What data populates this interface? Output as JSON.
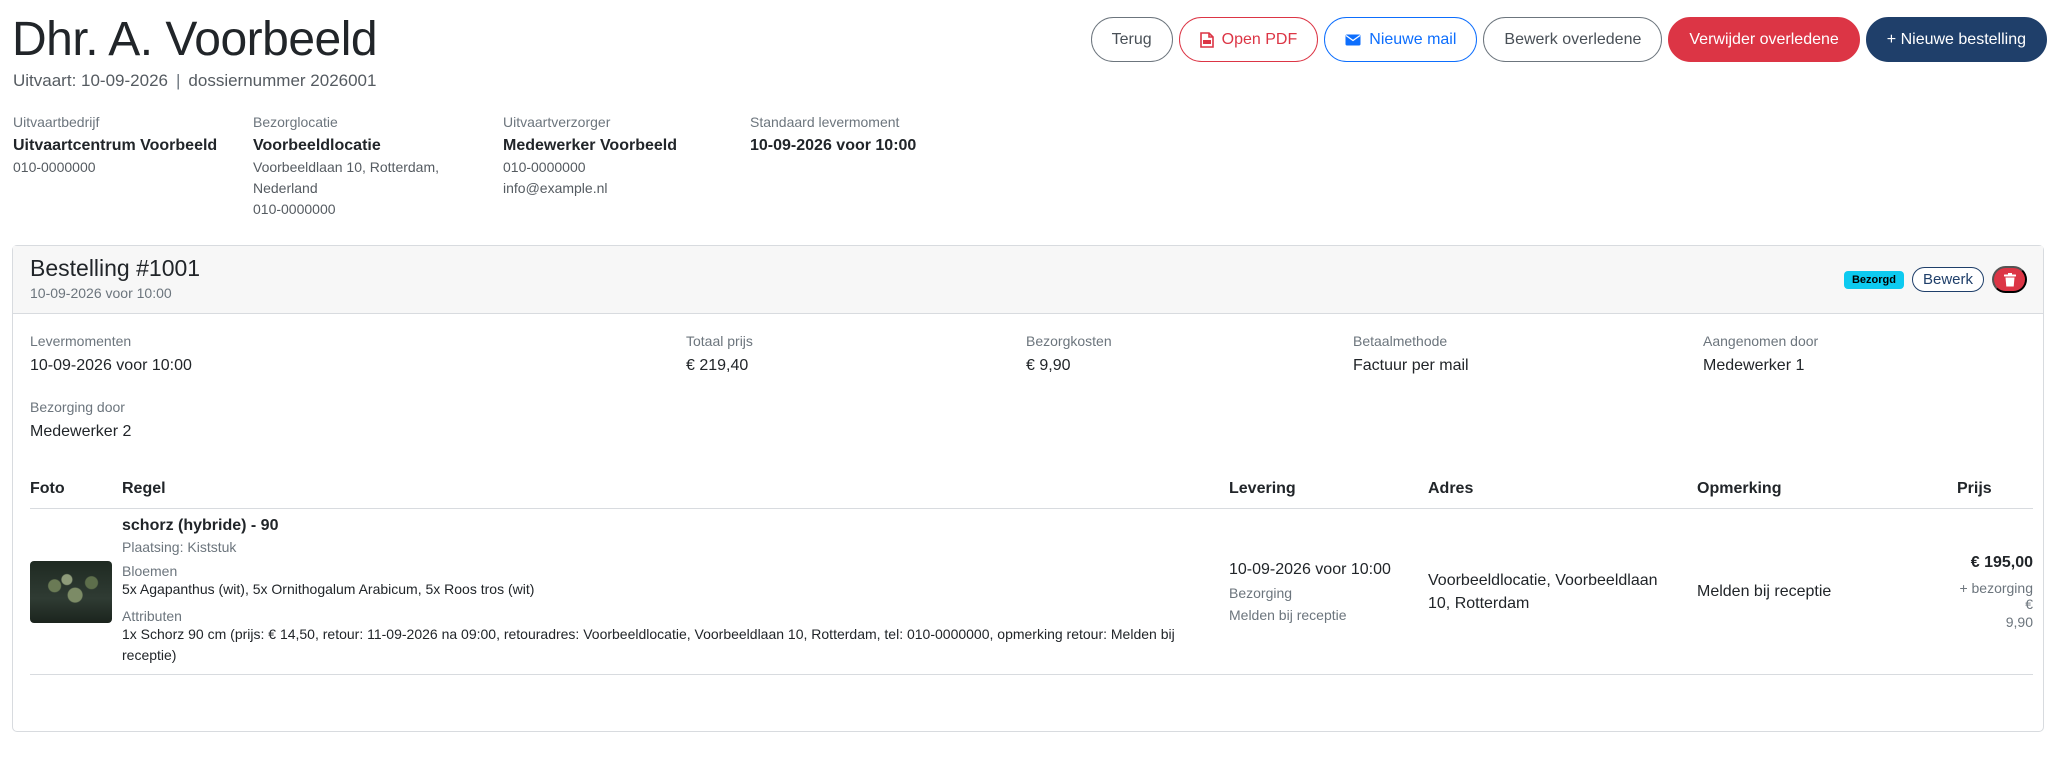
{
  "header": {
    "title": "Dhr. A. Voorbeeld",
    "funeral_label": "Uitvaart: 10-09-2026",
    "separator": "|",
    "dossier_label": "dossiernummer 2026001"
  },
  "actions": {
    "back": "Terug",
    "open_pdf": "Open PDF",
    "new_mail": "Nieuwe mail",
    "edit_deceased": "Bewerk overledene",
    "delete_deceased": "Verwijder overledene",
    "new_order": "+ Nieuwe bestelling"
  },
  "info": {
    "company": {
      "label": "Uitvaartbedrijf",
      "name": "Uitvaartcentrum Voorbeeld",
      "phone": "010-0000000"
    },
    "location": {
      "label": "Bezorglocatie",
      "name": "Voorbeeldlocatie",
      "address1": "Voorbeeldlaan 10, Rotterdam,",
      "address2": "Nederland",
      "phone": "010-0000000"
    },
    "caretaker": {
      "label": "Uitvaartverzorger",
      "name": "Medewerker Voorbeeld",
      "phone": "010-0000000",
      "email": "info@example.nl"
    },
    "delivery": {
      "label": "Standaard levermoment",
      "value": "10-09-2026 voor 10:00"
    }
  },
  "order": {
    "title": "Bestelling #1001",
    "subtitle": "10-09-2026 voor 10:00",
    "status_badge": "Bezorgd",
    "edit": "Bewerk",
    "fields": {
      "levermomenten": {
        "label": "Levermomenten",
        "value": "10-09-2026 voor 10:00"
      },
      "totaal": {
        "label": "Totaal prijs",
        "value": "€ 219,40"
      },
      "bezorgkosten": {
        "label": "Bezorgkosten",
        "value": "€ 9,90"
      },
      "betaalmethode": {
        "label": "Betaalmethode",
        "value": "Factuur per mail"
      },
      "aangenomen": {
        "label": "Aangenomen door",
        "value": "Medewerker 1"
      },
      "bezorging": {
        "label": "Bezorging door",
        "value": "Medewerker 2"
      }
    },
    "table": {
      "headers": {
        "foto": "Foto",
        "regel": "Regel",
        "levering": "Levering",
        "adres": "Adres",
        "opmerking": "Opmerking",
        "prijs": "Prijs"
      },
      "row": {
        "name": "schorz (hybride) - 90",
        "placement": "Plaatsing: Kiststuk",
        "flowers_label": "Bloemen",
        "flowers": "5x Agapanthus (wit), 5x Ornithogalum Arabicum, 5x Roos tros (wit)",
        "attributes_label": "Attributen",
        "attributes": "1x Schorz 90 cm (prijs: € 14,50, retour: 11-09-2026 na 09:00, retouradres: Voorbeeldlocatie, Voorbeeldlaan 10, Rotterdam, tel: 010-0000000, opmerking retour: Melden bij receptie)",
        "delivery_time": "10-09-2026 voor 10:00",
        "delivery_type": "Bezorging",
        "delivery_note": "Melden bij receptie",
        "address": "Voorbeeldlocatie, Voorbeeldlaan 10, Rotterdam",
        "remark": "Melden bij receptie",
        "price": "€ 195,00",
        "price_extra_1": "+ bezorging €",
        "price_extra_2": "9,90"
      }
    }
  },
  "colors": {
    "primary_navy": "#1f3f6a",
    "danger": "#dc3545",
    "info": "#0dcaf0",
    "blue": "#0d6efd"
  }
}
